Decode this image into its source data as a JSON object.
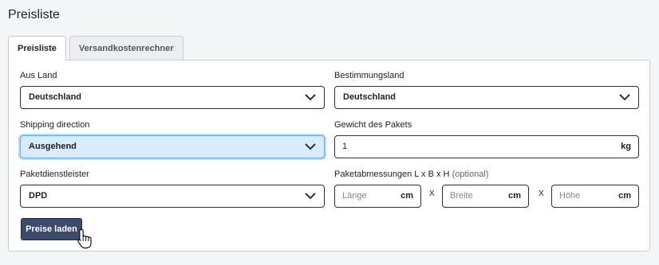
{
  "page": {
    "title": "Preisliste"
  },
  "tabs": [
    {
      "label": "Preisliste",
      "active": true
    },
    {
      "label": "Versandkostenrechner",
      "active": false
    }
  ],
  "form": {
    "from_country": {
      "label": "Aus Land",
      "value": "Deutschland"
    },
    "dest_country": {
      "label": "Bestimmungsland",
      "value": "Deutschland"
    },
    "shipping_direction": {
      "label": "Shipping direction",
      "value": "Ausgehend"
    },
    "weight": {
      "label": "Gewicht des Pakets",
      "value": "1",
      "unit": "kg"
    },
    "carrier": {
      "label": "Paketdienstleister",
      "value": "DPD"
    },
    "dimensions": {
      "label": "Paketabmessungen L x B x H",
      "optional": "(optional)",
      "separator": "X",
      "length": {
        "placeholder": "Länge",
        "unit": "cm"
      },
      "width": {
        "placeholder": "Breite",
        "unit": "cm"
      },
      "height": {
        "placeholder": "Höhe",
        "unit": "cm"
      }
    },
    "submit_label": "Preise laden"
  },
  "colors": {
    "button_bg": "#3c4a6b",
    "focus_bg": "#d9ecff",
    "focus_border": "#6aa7e6"
  },
  "icons": {
    "dropdown": "chevron-down-icon",
    "cursor": "hand-pointer-cursor-icon"
  }
}
